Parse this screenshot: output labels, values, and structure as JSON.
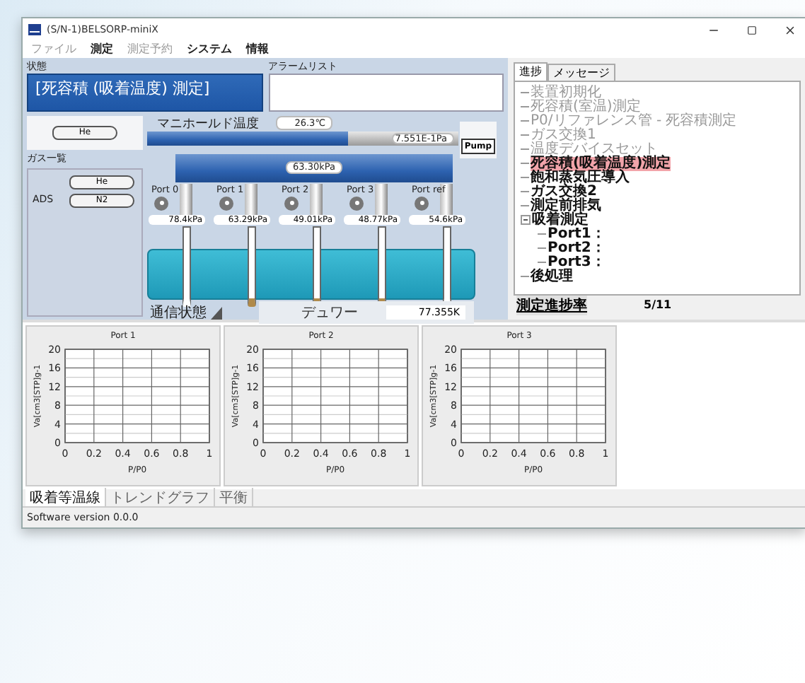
{
  "window": {
    "title": "(S/N-1)BELSORP-miniX"
  },
  "menu": [
    {
      "label": "ファイル",
      "disabled": true
    },
    {
      "label": "測定",
      "disabled": false
    },
    {
      "label": "測定予約",
      "disabled": true
    },
    {
      "label": "システム",
      "disabled": false
    },
    {
      "label": "情報",
      "disabled": false
    }
  ],
  "status": {
    "label": "状態",
    "value": "[死容積 (吸着温度) 測定]"
  },
  "alarm_list": {
    "label": "アラームリスト"
  },
  "diagram": {
    "gas_source": "He",
    "manifold_temp_label": "マニホールド温度",
    "manifold_temp": "26.3℃",
    "vacuum_pressure": "7.551E-1Pa",
    "pump": "Pump",
    "manifold_pressure": "63.30kPa",
    "gas_list_label": "ガス一覧",
    "gases": [
      {
        "name": "He"
      },
      {
        "label": "ADS",
        "name": "N2"
      }
    ],
    "ports": [
      {
        "name": "Port 0",
        "pressure": "78.4kPa",
        "sample": false
      },
      {
        "name": "Port 1",
        "pressure": "63.29kPa",
        "sample": true
      },
      {
        "name": "Port 2",
        "pressure": "49.01kPa",
        "sample": true
      },
      {
        "name": "Port 3",
        "pressure": "48.77kPa",
        "sample": true
      },
      {
        "name": "Port ref",
        "pressure": "54.6kPa",
        "sample": false
      }
    ],
    "comm_label": "通信状態",
    "dewar_label": "デュワー",
    "dewar_value": "77.355K"
  },
  "progress_panel": {
    "tabs": [
      {
        "label": "進捗",
        "selected": true
      },
      {
        "label": "メッセージ",
        "selected": false
      }
    ],
    "steps": [
      {
        "label": "装置初期化",
        "done": true,
        "current": false
      },
      {
        "label": "死容積(室温)測定",
        "done": true,
        "current": false
      },
      {
        "label": "P0/リファレンス管 - 死容積測定",
        "done": true,
        "current": false
      },
      {
        "label": "ガス交換1",
        "done": true,
        "current": false
      },
      {
        "label": "温度デバイスセット",
        "done": true,
        "current": false
      },
      {
        "label": "死容積(吸着温度)測定",
        "done": false,
        "current": true
      },
      {
        "label": "飽和蒸気圧導入",
        "done": false,
        "current": false
      },
      {
        "label": "ガス交換2",
        "done": false,
        "current": false
      },
      {
        "label": "測定前排気",
        "done": false,
        "current": false
      },
      {
        "label": "吸着測定",
        "done": false,
        "current": false,
        "expanded": true,
        "children": [
          {
            "label": "Port1：",
            "done": false,
            "current": false
          },
          {
            "label": "Port2：",
            "done": false,
            "current": false
          },
          {
            "label": "Port3：",
            "done": false,
            "current": false
          }
        ]
      },
      {
        "label": "後処理",
        "done": false,
        "current": false
      }
    ],
    "footer_label": "測定進捗率",
    "footer_value": "5/11"
  },
  "charts": [
    {
      "chart_data": {
        "type": "line",
        "grid": true,
        "title": "Port 1",
        "xlabel": "P/P0",
        "ylabel": "Va[cm3[STP]g-1",
        "xlim": [
          0,
          1
        ],
        "ylim": [
          0,
          20
        ],
        "xticks": [
          0,
          0.2,
          0.4,
          0.6,
          0.8,
          1
        ],
        "yticks": [
          0,
          4,
          8,
          12,
          16,
          20
        ]
      }
    },
    {
      "chart_data": {
        "type": "line",
        "grid": true,
        "title": "Port 2",
        "xlabel": "P/P0",
        "ylabel": "Va[cm3[STP]g-1",
        "xlim": [
          0,
          1
        ],
        "ylim": [
          0,
          20
        ],
        "xticks": [
          0,
          0.2,
          0.4,
          0.6,
          0.8,
          1
        ],
        "yticks": [
          0,
          4,
          8,
          12,
          16,
          20
        ]
      }
    },
    {
      "chart_data": {
        "type": "line",
        "grid": true,
        "title": "Port 3",
        "xlabel": "P/P0",
        "ylabel": "Va[cm3[STP]g-1",
        "xlim": [
          0,
          1
        ],
        "ylim": [
          0,
          20
        ],
        "xticks": [
          0,
          0.2,
          0.4,
          0.6,
          0.8,
          1
        ],
        "yticks": [
          0,
          4,
          8,
          12,
          16,
          20
        ]
      }
    }
  ],
  "bottom_tabs": [
    {
      "label": "吸着等温線",
      "selected": true
    },
    {
      "label": "トレンドグラフ",
      "selected": false
    },
    {
      "label": "平衡",
      "selected": false
    }
  ],
  "status_bar": "Software version 0.0.0"
}
